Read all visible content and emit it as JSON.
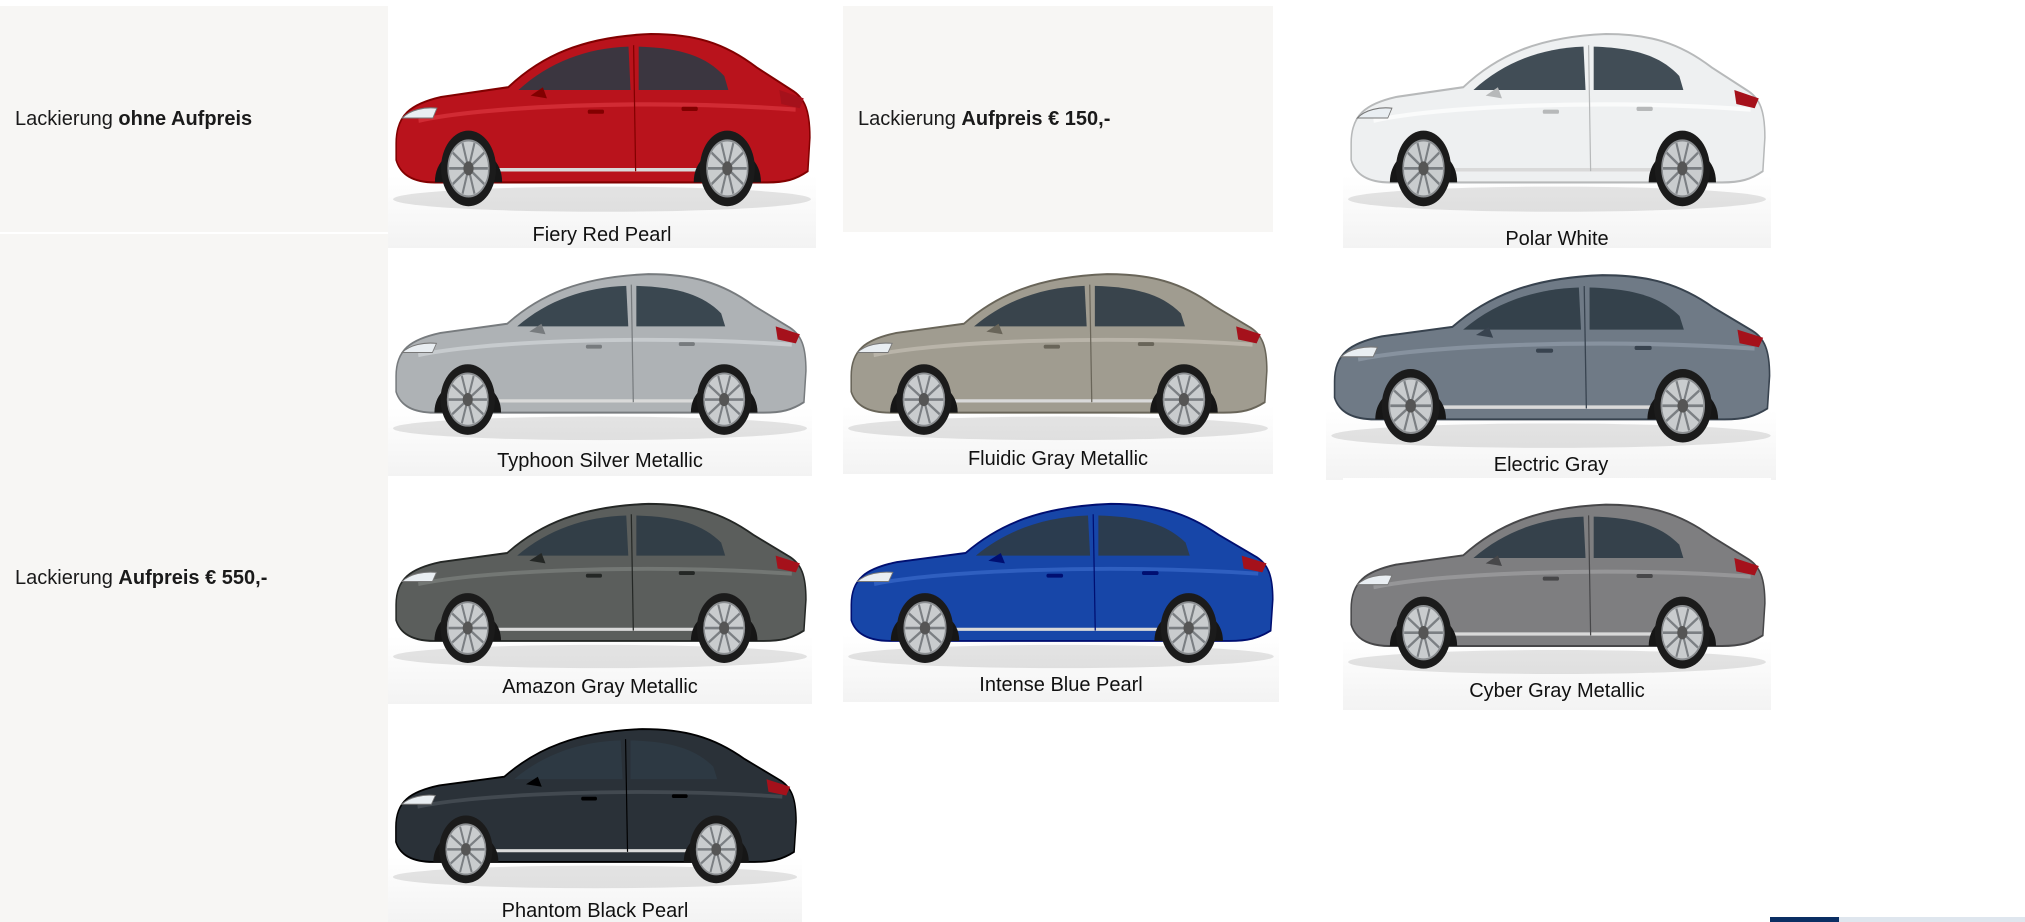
{
  "tiers": [
    {
      "prefix": "Lackierung ",
      "emph": "ohne Aufpreis"
    },
    {
      "prefix": "Lackierung ",
      "emph": "Aufpreis € 150,-"
    },
    {
      "prefix": "Lackierung ",
      "emph": "Aufpreis € 550,-"
    }
  ],
  "colors": [
    {
      "name": "Fiery Red Pearl",
      "hex": "#b9131c"
    },
    {
      "name": "Polar White",
      "hex": "#eef0f1"
    },
    {
      "name": "Typhoon Silver Metallic",
      "hex": "#aeb2b5"
    },
    {
      "name": "Fluidic Gray Metallic",
      "hex": "#a09c90"
    },
    {
      "name": "Electric Gray",
      "hex": "#6f7a86"
    },
    {
      "name": "Amazon Gray Metallic",
      "hex": "#5b5e5c"
    },
    {
      "name": "Intense Blue Pearl",
      "hex": "#1746a8"
    },
    {
      "name": "Cyber Gray Metallic",
      "hex": "#7e7e80"
    },
    {
      "name": "Phantom Black Pearl",
      "hex": "#2a3138"
    }
  ],
  "progress": {
    "fraction": 0.27
  }
}
